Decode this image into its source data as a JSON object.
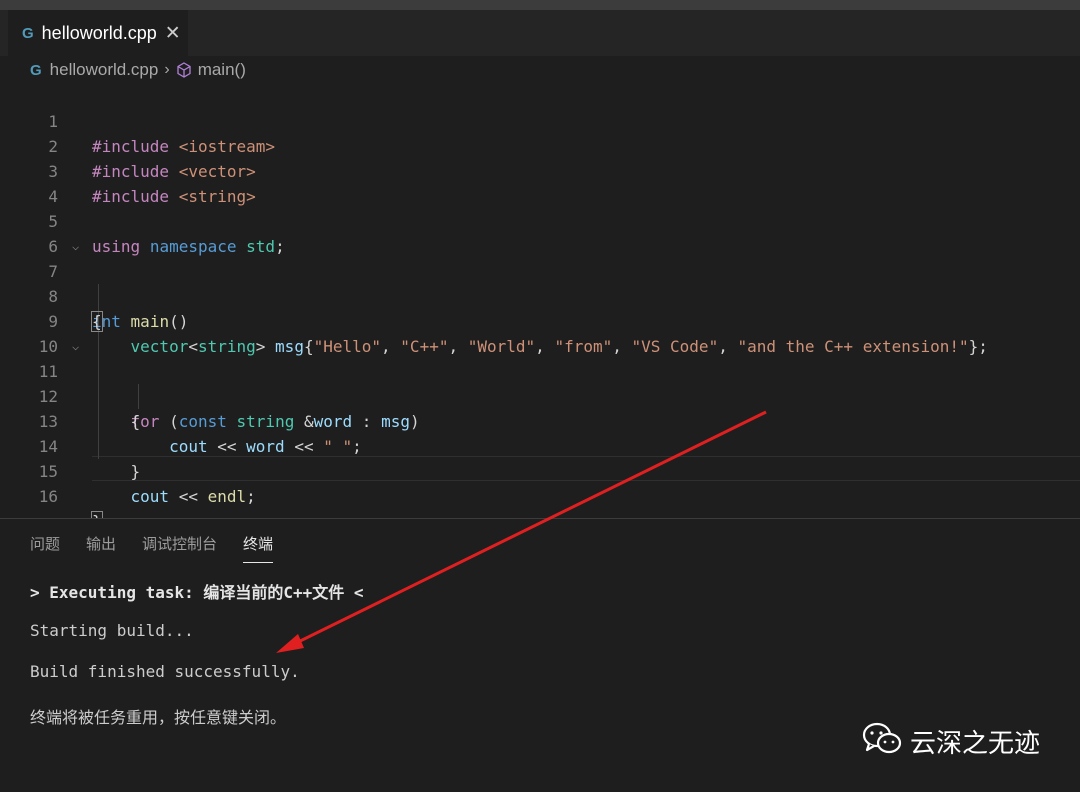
{
  "tab": {
    "filename": "helloworld.cpp",
    "close_glyph": "✕"
  },
  "breadcrumb": {
    "file": "helloworld.cpp",
    "symbol": "main()"
  },
  "editor": {
    "line_numbers": [
      "1",
      "2",
      "3",
      "4",
      "5",
      "6",
      "7",
      "8",
      "9",
      "10",
      "11",
      "12",
      "13",
      "14",
      "15",
      "16"
    ]
  },
  "panel": {
    "tabs": [
      "问题",
      "输出",
      "调试控制台",
      "终端"
    ],
    "active_tab": "终端",
    "terminal_lines": [
      "> Executing task: 编译当前的C++文件 <",
      "Starting build...",
      "Build finished successfully.",
      "终端将被任务重用，按任意键关闭。"
    ]
  },
  "watermark": {
    "text": "云深之无迹"
  },
  "colors": {
    "arrow": "#e02020",
    "accent_cpp": "#519aba"
  }
}
